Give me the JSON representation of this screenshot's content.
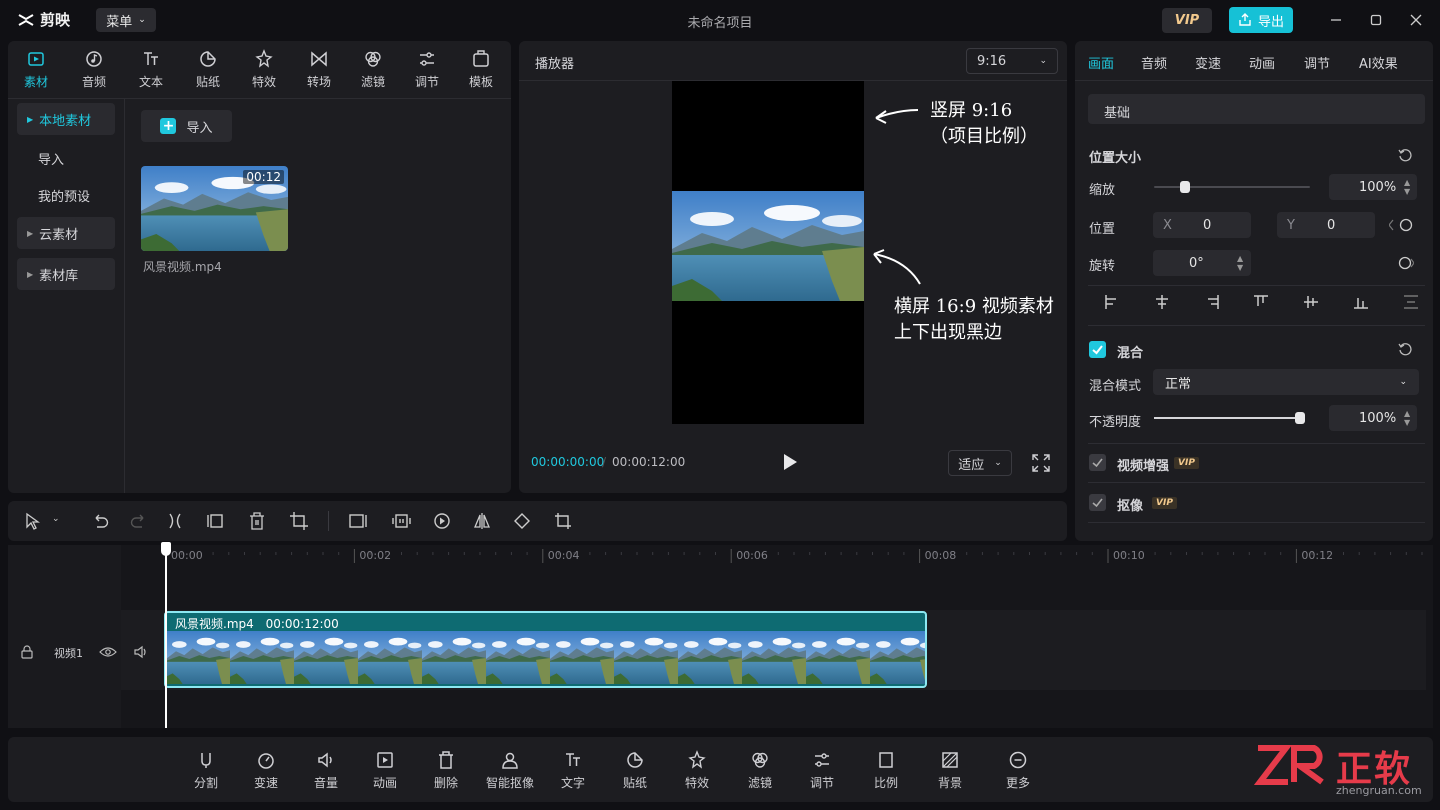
{
  "app": {
    "name": "剪映",
    "menu_label": "菜单",
    "project_title": "未命名项目",
    "vip_label": "VIP",
    "export_label": "导出"
  },
  "media_tabs": [
    {
      "label": "素材",
      "icon": "media-icon"
    },
    {
      "label": "音频",
      "icon": "audio-icon"
    },
    {
      "label": "文本",
      "icon": "text-icon"
    },
    {
      "label": "贴纸",
      "icon": "sticker-icon"
    },
    {
      "label": "特效",
      "icon": "effects-icon"
    },
    {
      "label": "转场",
      "icon": "transition-icon"
    },
    {
      "label": "滤镜",
      "icon": "filter-icon"
    },
    {
      "label": "调节",
      "icon": "adjust-icon"
    },
    {
      "label": "模板",
      "icon": "template-icon"
    }
  ],
  "media_sidebar": {
    "local": "本地素材",
    "import": "导入",
    "presets": "我的预设",
    "cloud": "云素材",
    "library": "素材库"
  },
  "media_import_button": "导入",
  "media_clip": {
    "duration": "00:12",
    "filename": "风景视频.mp4"
  },
  "player": {
    "title": "播放器",
    "ratio": "9:16",
    "current_time": "00:00:00:00",
    "total_time": "00:00:12:00",
    "fit_label": "适应"
  },
  "annotations": {
    "top_line1": "竖屏 9:16",
    "top_line2": "（项目比例）",
    "bottom_line1": "横屏 16:9 视频素材",
    "bottom_line2": "上下出现黑边"
  },
  "inspector": {
    "tabs": [
      "画面",
      "音频",
      "变速",
      "动画",
      "调节",
      "AI效果"
    ],
    "section_basic": "基础",
    "position_size": "位置大小",
    "scale_label": "缩放",
    "scale_value": "100%",
    "scale_fraction": 0.2,
    "position_label": "位置",
    "x_label": "X",
    "x_value": "0",
    "y_label": "Y",
    "y_value": "0",
    "rotate_label": "旋转",
    "rotate_value": "0°",
    "blend_label": "混合",
    "blend_mode_label": "混合模式",
    "blend_mode_value": "正常",
    "opacity_label": "不透明度",
    "opacity_value": "100%",
    "opacity_fraction": 1.0,
    "enhance_label": "视频增强",
    "cutout_label": "抠像",
    "vip_tag": "VIP"
  },
  "timeline": {
    "ruler": [
      "00:00",
      "00:02",
      "00:04",
      "00:06",
      "00:08",
      "00:10",
      "00:12"
    ],
    "track_name": "视频1",
    "clip_name": "风景视频.mp4",
    "clip_duration": "00:00:12:00"
  },
  "bottom_bar": [
    {
      "label": "分割",
      "icon": "split-icon"
    },
    {
      "label": "变速",
      "icon": "speed-icon"
    },
    {
      "label": "音量",
      "icon": "volume-icon"
    },
    {
      "label": "动画",
      "icon": "animation-icon"
    },
    {
      "label": "删除",
      "icon": "delete-icon"
    },
    {
      "label": "智能抠像",
      "icon": "smart-cutout-icon"
    },
    {
      "label": "文字",
      "icon": "text-icon"
    },
    {
      "label": "贴纸",
      "icon": "sticker-icon"
    },
    {
      "label": "特效",
      "icon": "effects-icon"
    },
    {
      "label": "滤镜",
      "icon": "filter-icon"
    },
    {
      "label": "调节",
      "icon": "adjust-icon"
    },
    {
      "label": "比例",
      "icon": "ratio-icon"
    },
    {
      "label": "背景",
      "icon": "background-icon"
    },
    {
      "label": "更多",
      "icon": "more-icon"
    }
  ],
  "watermark": {
    "brand": "正软",
    "site": "zhengruan.com"
  }
}
